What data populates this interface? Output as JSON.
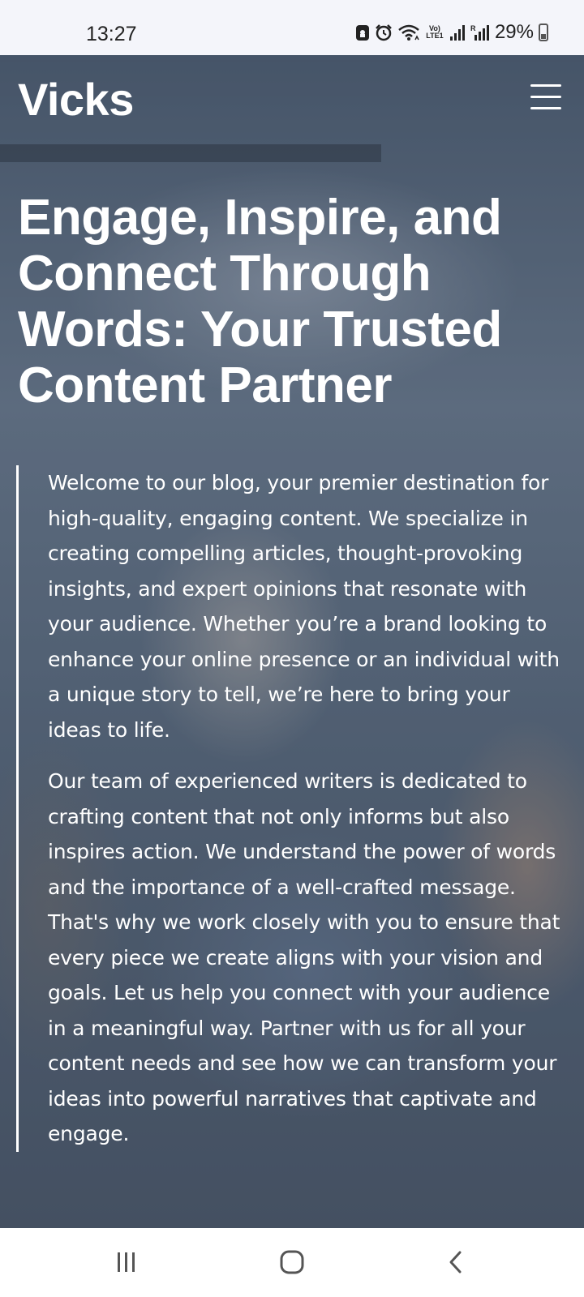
{
  "status_bar": {
    "time": "13:27",
    "lte_label": "Vo) LTE1",
    "battery_percent": "29%",
    "icons": [
      "lock-app-icon",
      "alarm-icon",
      "wifi-icon",
      "volte-icon",
      "signal-icon",
      "signal-roaming-icon",
      "battery-icon"
    ]
  },
  "header": {
    "brand": "Vicks",
    "menu_icon": "hamburger-menu-icon"
  },
  "hero": {
    "headline": "Engage, Inspire, and Connect Through Words: Your Trusted Content Partner",
    "paragraphs": [
      "Welcome to our blog, your premier destination for high-quality, engaging content. We specialize in creating compelling articles, thought-provoking insights, and expert opinions that resonate with your audience. Whether you’re a brand looking to enhance your online presence or an individual with a unique story to tell, we’re here to bring your ideas to life.",
      "Our team of experienced writers is dedicated to crafting content that not only informs but also inspires action. We understand the power of words and the importance of a well-crafted message. That's why we work closely with you to ensure that every piece we create aligns with your vision and goals. Let us help you connect with your audience in a meaningful way. Partner with us for all your content needs and see how we can transform your ideas into powerful narratives that captivate and engage."
    ]
  },
  "nav_bar": {
    "buttons": [
      "recent-apps-icon",
      "home-icon",
      "back-icon"
    ]
  },
  "colors": {
    "status_bar_bg": "#f4f5fa",
    "hero_overlay": "#4c5b6e",
    "text": "#ffffff"
  }
}
